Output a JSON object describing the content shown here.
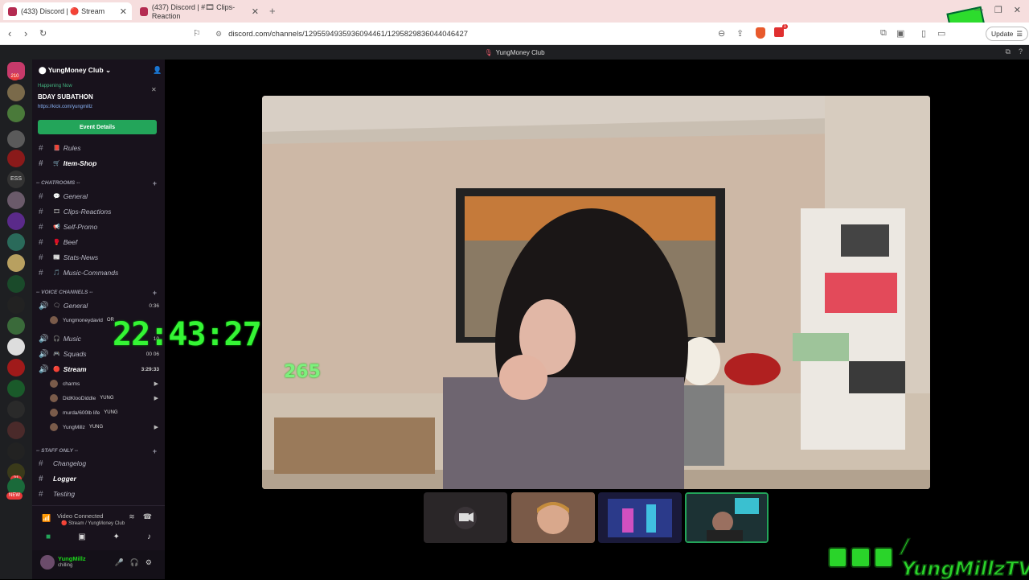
{
  "browser": {
    "tabs": [
      {
        "label": "(433) Discord | 🔴 Stream"
      },
      {
        "label": "(437) Discord | #🎞 Clips-Reaction"
      }
    ],
    "url": "discord.com/channels/1295594935936094461/1295829836044046427",
    "update_label": "Update",
    "alert_count": "1"
  },
  "discord": {
    "window_title": "YungMoney Club",
    "server_name": "YungMoney Club",
    "event": {
      "status": "Happening Now",
      "title": "BDAY SUBATHON",
      "link": "https://kick.com/yungmillz",
      "button": "Event Details"
    },
    "top_channels": [
      {
        "emoji": "📕",
        "name": "Rules"
      },
      {
        "emoji": "🛒",
        "name": "Item-Shop"
      }
    ],
    "categories": {
      "chat": "-- CHATROOMS --",
      "voice": "-- VOICE CHANNELS --",
      "staff": "-- STAFF ONLY --"
    },
    "chat_channels": [
      {
        "emoji": "💬",
        "name": "General"
      },
      {
        "emoji": "🎞",
        "name": "Clips-Reactions"
      },
      {
        "emoji": "📢",
        "name": "Self-Promo"
      },
      {
        "emoji": "🥊",
        "name": "Beef"
      },
      {
        "emoji": "📰",
        "name": "Stats-News"
      },
      {
        "emoji": "🎵",
        "name": "Music-Commands"
      }
    ],
    "voice_channels": [
      {
        "emoji": "🗨",
        "name": "General",
        "meta": "0:36"
      },
      {
        "emoji": "🎧",
        "name": "Music",
        "meta": "10"
      },
      {
        "emoji": "🎮",
        "name": "Squads",
        "meta": "00 06"
      },
      {
        "emoji": "🔴",
        "name": "Stream",
        "meta": "3:29:33"
      }
    ],
    "general_member": {
      "name": "Yungmoneydavid",
      "tag": "OR"
    },
    "stream_members": [
      {
        "name": "charms",
        "tag": ""
      },
      {
        "name": "DidKlooDiddle",
        "tag": "YUNG"
      },
      {
        "name": "murda/600lb life",
        "tag": "YUNG"
      },
      {
        "name": "YungMillz",
        "tag": "YUNG"
      }
    ],
    "staff_channels": [
      {
        "name": "Changelog"
      },
      {
        "name": "Logger"
      },
      {
        "name": "Testing"
      }
    ],
    "voice_connected": {
      "title": "Video Connected",
      "sub": "🔴 Stream / YungMoney Club"
    },
    "user": {
      "name": "YungMillz",
      "status": "chilling"
    },
    "rail_badges": [
      "210",
      "1",
      "2",
      "ESS",
      "21",
      "NEW"
    ]
  },
  "overlay": {
    "clock": "22:43:27",
    "counter": "265",
    "handle": "/ YungMillzTV",
    "logo_text": "YUNGMILLZ"
  },
  "colors": {
    "accent_green": "#23a55a",
    "overlay_green": "#35f535",
    "sidebar_bg": "#18121c"
  }
}
